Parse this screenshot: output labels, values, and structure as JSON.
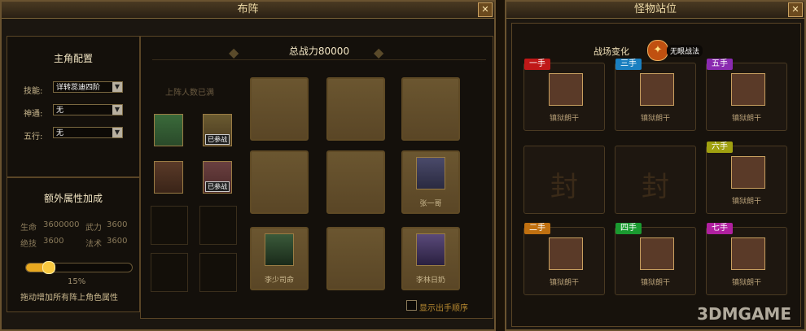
{
  "left_panel": {
    "title": "布阵",
    "close": "✕",
    "config": {
      "heading": "主角配置",
      "skill_label": "技能:",
      "skill_value": "详转蕊迪四阶",
      "shentong_label": "神通:",
      "shentong_value": "无",
      "wuxing_label": "五行:",
      "wuxing_value": "无"
    },
    "extra": {
      "heading": "额外属性加成",
      "hp_label": "生命",
      "hp_value": "3600000",
      "atk_label": "武力",
      "atk_value": "3600",
      "skill_label": "绝技",
      "skill_value": "3600",
      "magic_label": "法术",
      "magic_value": "3600",
      "slider_percent": 15,
      "slider_text": "15%",
      "hint": "拖动增加所有阵上角色属性"
    },
    "formation": {
      "power_label": "总战力80000",
      "full_notice": "上阵人数已满",
      "recruited_badge": "已参战",
      "unit_zhang": "张一哥",
      "unit_li": "李少司命",
      "unit_lin": "李林日奶",
      "show_order_label": "显示出手顺序"
    }
  },
  "right_panel": {
    "title": "怪物站位",
    "close": "✕",
    "battle_change": "战场变化",
    "battle_mode": "无眼战法",
    "seal_char": "封",
    "monster_name": "镇狱朗干",
    "slots": [
      {
        "tag": "一手",
        "color": "#c01818"
      },
      {
        "tag": "三手",
        "color": "#1a7fc0"
      },
      {
        "tag": "五手",
        "color": "#8a2ab0"
      },
      {
        "tag": "六手",
        "color": "#a0a010"
      },
      {
        "tag": "二手",
        "color": "#c07010"
      },
      {
        "tag": "四手",
        "color": "#1a9a30"
      },
      {
        "tag": "七手",
        "color": "#b020a0"
      }
    ]
  },
  "watermark": "3DMGAME"
}
